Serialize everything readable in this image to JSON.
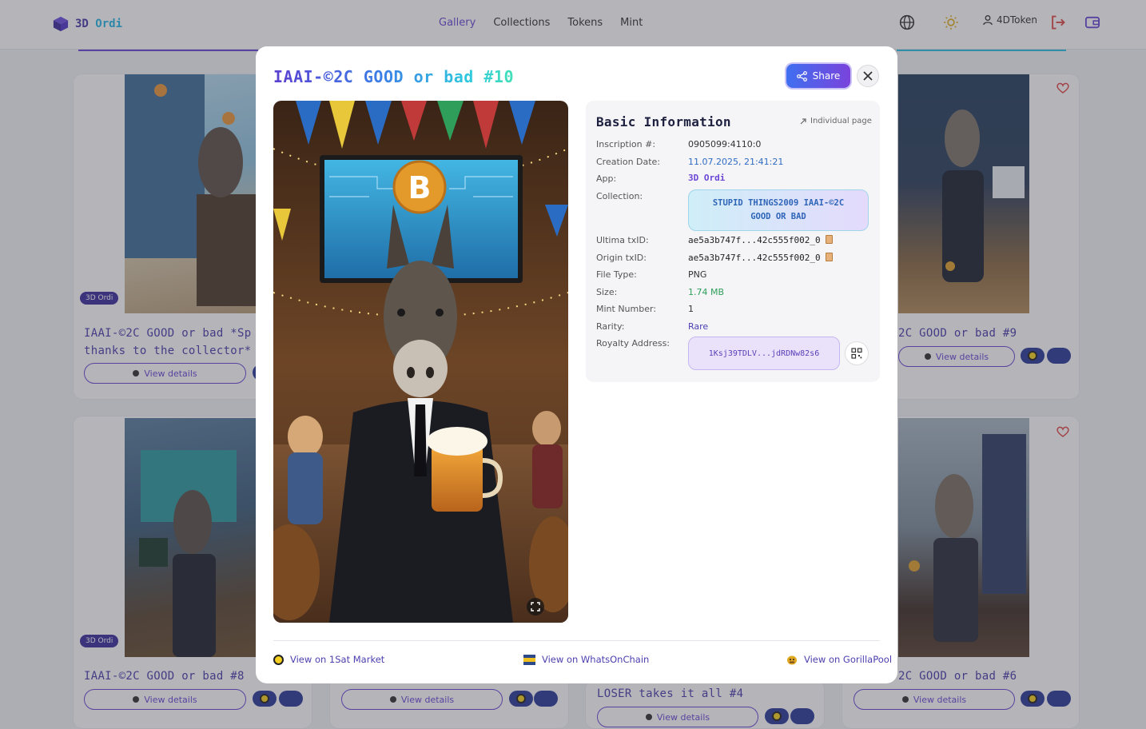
{
  "app": {
    "name_part1": "3D",
    "name_part2": " Ordi"
  },
  "nav": {
    "items": [
      "Gallery",
      "Collections",
      "Tokens",
      "Mint"
    ],
    "active": "Gallery"
  },
  "user": {
    "name": "4DToken"
  },
  "colors": {
    "primary": "#6a46d6",
    "accent": "#2bc0e4",
    "danger": "#e04848",
    "success": "#2f9e5a"
  },
  "background_cards": {
    "app_badge": "3D Ordi",
    "view_details": "View details",
    "titles": {
      "top_left_line1": "IAAI-©2C GOOD or bad *Sp",
      "top_left_line2": "thanks to the collector*",
      "top_right": "2C GOOD or bad #9",
      "bottom_left": "IAAI-©2C GOOD or bad #8",
      "bottom_center": "LOSER takes it all #4",
      "bottom_right": "2C GOOD or bad #6"
    }
  },
  "modal": {
    "title": "IAAI-©2C GOOD or bad #10",
    "share_label": "Share",
    "info": {
      "heading": "Basic Information",
      "individual_page": "Individual page",
      "rows": {
        "inscription_label": "Inscription #:",
        "inscription_value": "0905099:4110:0",
        "creation_label": "Creation Date:",
        "creation_value": "11.07.2025, 21:41:21",
        "app_label": "App:",
        "app_value": "3D Ordi",
        "collection_label": "Collection:",
        "collection_value": "STUPID THINGS2009 IAAI-©2C GOOD OR BAD",
        "ultima_label": "Ultima txID:",
        "ultima_value": "ae5a3b747f...42c555f002_0",
        "origin_label": "Origin txID:",
        "origin_value": "ae5a3b747f...42c555f002_0",
        "filetype_label": "File Type:",
        "filetype_value": "PNG",
        "size_label": "Size:",
        "size_value": "1.74 MB",
        "mint_label": "Mint Number:",
        "mint_value": "1",
        "rarity_label": "Rarity:",
        "rarity_value": "Rare",
        "royalty_label": "Royalty Address:",
        "royalty_value": "1Ksj39TDLV...jdRDNw82s6"
      }
    },
    "footer_links": {
      "market": "View on 1Sat Market",
      "woc": "View on WhatsOnChain",
      "gorilla": "View on GorillaPool"
    }
  }
}
